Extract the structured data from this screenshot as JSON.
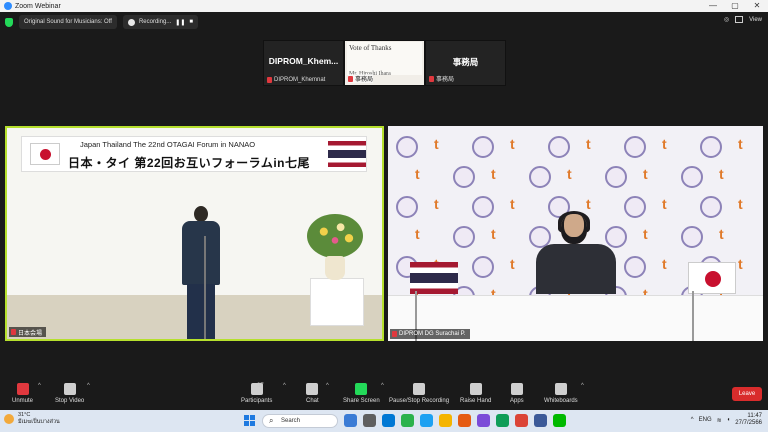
{
  "window": {
    "title": "Zoom Webinar",
    "controls": [
      "—",
      "▢",
      "✕"
    ]
  },
  "topbar": {
    "audio_pill": "Original Sound for Musicians: Off",
    "recording_pill": "Recording...",
    "view_label": "View"
  },
  "thumbnails": [
    {
      "name": "DIPROM_Khem...",
      "label": "DIPROM_Khemnat"
    },
    {
      "doc_title": "Vote of Thanks",
      "doc_sub": "Mr. Hiroshi Ihara",
      "label": "事務局"
    },
    {
      "name": "事務局",
      "label": "事務局"
    }
  ],
  "video_left": {
    "banner_en": "Japan Thailand The 22nd OTAGAI Forum in NANAO",
    "banner_jp": "日本・タイ 第22回お互いフォーラムin七尾",
    "nametag": "日本会場"
  },
  "video_right": {
    "nametag": "DIPROM DG Surachai P."
  },
  "toolbar": {
    "unmute": "Unmute",
    "stop_video": "Stop Video",
    "participants": "Participants",
    "participants_count": "37",
    "chat": "Chat",
    "share_screen": "Share Screen",
    "recording": "Pause/Stop Recording",
    "raise_hand": "Raise Hand",
    "apps": "Apps",
    "whiteboards": "Whiteboards",
    "leave": "Leave"
  },
  "taskbar": {
    "weather_temp": "31°C",
    "weather_text": "มีเมฆเป็นบางส่วน",
    "search": "Search",
    "lang": "ENG",
    "time": "11:47",
    "date": "27/7/2566",
    "app_colors": [
      "#3a7bd5",
      "#5f5f5f",
      "#0078d4",
      "#2bb24c",
      "#1da1f2",
      "#f4b400",
      "#e55b13",
      "#7b4bd8",
      "#0f9d58",
      "#db4437",
      "#3b5998",
      "#00b900"
    ]
  }
}
